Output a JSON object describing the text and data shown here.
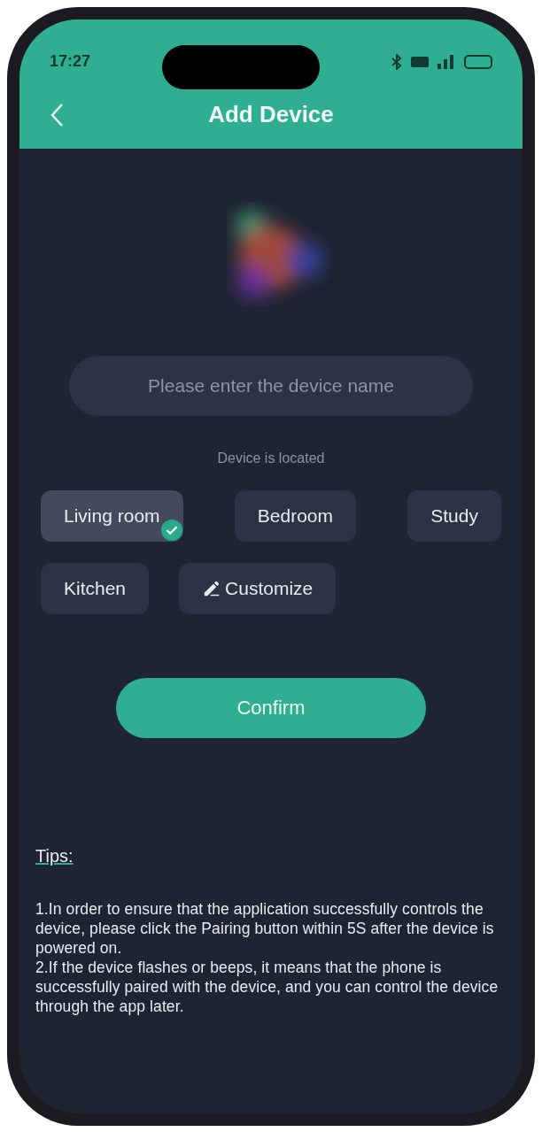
{
  "status_bar": {
    "time": "17:27"
  },
  "header": {
    "title": "Add Device"
  },
  "name_field": {
    "placeholder": "Please enter the device name"
  },
  "location": {
    "label": "Device is located",
    "options": [
      {
        "label": "Living room",
        "selected": true,
        "kind": "room"
      },
      {
        "label": "Bedroom",
        "selected": false,
        "kind": "room"
      },
      {
        "label": "Study",
        "selected": false,
        "kind": "room"
      },
      {
        "label": "Kitchen",
        "selected": false,
        "kind": "room"
      },
      {
        "label": "Customize",
        "selected": false,
        "kind": "custom"
      }
    ]
  },
  "confirm_button": "Confirm",
  "tips": {
    "title": "Tips:",
    "items": [
      "1.In order to ensure that the application successfully controls the device, please click the Pairing button within 5S after the device is powered on.",
      "2.If the device flashes or beeps, it means that the phone is successfully paired with the device, and you can control the device through the app later."
    ]
  }
}
